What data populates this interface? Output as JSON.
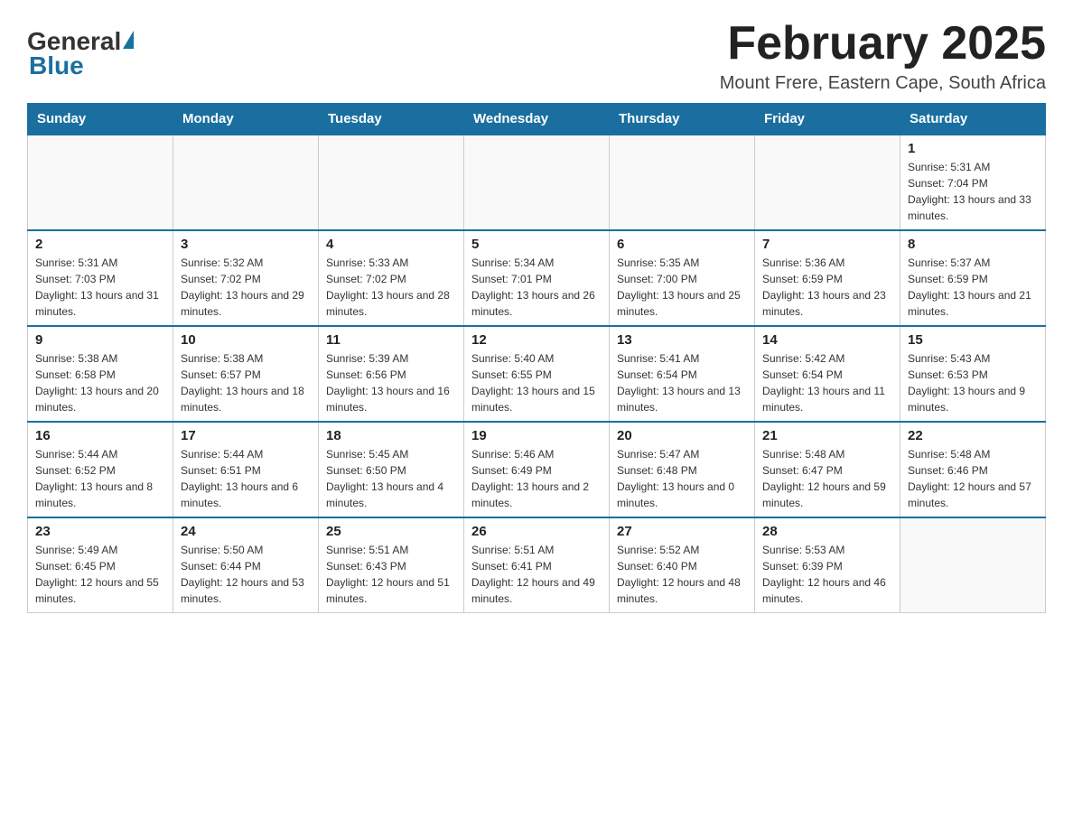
{
  "logo": {
    "general": "General",
    "blue": "Blue"
  },
  "title": "February 2025",
  "subtitle": "Mount Frere, Eastern Cape, South Africa",
  "days_of_week": [
    "Sunday",
    "Monday",
    "Tuesday",
    "Wednesday",
    "Thursday",
    "Friday",
    "Saturday"
  ],
  "weeks": [
    [
      {
        "day": "",
        "info": ""
      },
      {
        "day": "",
        "info": ""
      },
      {
        "day": "",
        "info": ""
      },
      {
        "day": "",
        "info": ""
      },
      {
        "day": "",
        "info": ""
      },
      {
        "day": "",
        "info": ""
      },
      {
        "day": "1",
        "info": "Sunrise: 5:31 AM\nSunset: 7:04 PM\nDaylight: 13 hours and 33 minutes."
      }
    ],
    [
      {
        "day": "2",
        "info": "Sunrise: 5:31 AM\nSunset: 7:03 PM\nDaylight: 13 hours and 31 minutes."
      },
      {
        "day": "3",
        "info": "Sunrise: 5:32 AM\nSunset: 7:02 PM\nDaylight: 13 hours and 29 minutes."
      },
      {
        "day": "4",
        "info": "Sunrise: 5:33 AM\nSunset: 7:02 PM\nDaylight: 13 hours and 28 minutes."
      },
      {
        "day": "5",
        "info": "Sunrise: 5:34 AM\nSunset: 7:01 PM\nDaylight: 13 hours and 26 minutes."
      },
      {
        "day": "6",
        "info": "Sunrise: 5:35 AM\nSunset: 7:00 PM\nDaylight: 13 hours and 25 minutes."
      },
      {
        "day": "7",
        "info": "Sunrise: 5:36 AM\nSunset: 6:59 PM\nDaylight: 13 hours and 23 minutes."
      },
      {
        "day": "8",
        "info": "Sunrise: 5:37 AM\nSunset: 6:59 PM\nDaylight: 13 hours and 21 minutes."
      }
    ],
    [
      {
        "day": "9",
        "info": "Sunrise: 5:38 AM\nSunset: 6:58 PM\nDaylight: 13 hours and 20 minutes."
      },
      {
        "day": "10",
        "info": "Sunrise: 5:38 AM\nSunset: 6:57 PM\nDaylight: 13 hours and 18 minutes."
      },
      {
        "day": "11",
        "info": "Sunrise: 5:39 AM\nSunset: 6:56 PM\nDaylight: 13 hours and 16 minutes."
      },
      {
        "day": "12",
        "info": "Sunrise: 5:40 AM\nSunset: 6:55 PM\nDaylight: 13 hours and 15 minutes."
      },
      {
        "day": "13",
        "info": "Sunrise: 5:41 AM\nSunset: 6:54 PM\nDaylight: 13 hours and 13 minutes."
      },
      {
        "day": "14",
        "info": "Sunrise: 5:42 AM\nSunset: 6:54 PM\nDaylight: 13 hours and 11 minutes."
      },
      {
        "day": "15",
        "info": "Sunrise: 5:43 AM\nSunset: 6:53 PM\nDaylight: 13 hours and 9 minutes."
      }
    ],
    [
      {
        "day": "16",
        "info": "Sunrise: 5:44 AM\nSunset: 6:52 PM\nDaylight: 13 hours and 8 minutes."
      },
      {
        "day": "17",
        "info": "Sunrise: 5:44 AM\nSunset: 6:51 PM\nDaylight: 13 hours and 6 minutes."
      },
      {
        "day": "18",
        "info": "Sunrise: 5:45 AM\nSunset: 6:50 PM\nDaylight: 13 hours and 4 minutes."
      },
      {
        "day": "19",
        "info": "Sunrise: 5:46 AM\nSunset: 6:49 PM\nDaylight: 13 hours and 2 minutes."
      },
      {
        "day": "20",
        "info": "Sunrise: 5:47 AM\nSunset: 6:48 PM\nDaylight: 13 hours and 0 minutes."
      },
      {
        "day": "21",
        "info": "Sunrise: 5:48 AM\nSunset: 6:47 PM\nDaylight: 12 hours and 59 minutes."
      },
      {
        "day": "22",
        "info": "Sunrise: 5:48 AM\nSunset: 6:46 PM\nDaylight: 12 hours and 57 minutes."
      }
    ],
    [
      {
        "day": "23",
        "info": "Sunrise: 5:49 AM\nSunset: 6:45 PM\nDaylight: 12 hours and 55 minutes."
      },
      {
        "day": "24",
        "info": "Sunrise: 5:50 AM\nSunset: 6:44 PM\nDaylight: 12 hours and 53 minutes."
      },
      {
        "day": "25",
        "info": "Sunrise: 5:51 AM\nSunset: 6:43 PM\nDaylight: 12 hours and 51 minutes."
      },
      {
        "day": "26",
        "info": "Sunrise: 5:51 AM\nSunset: 6:41 PM\nDaylight: 12 hours and 49 minutes."
      },
      {
        "day": "27",
        "info": "Sunrise: 5:52 AM\nSunset: 6:40 PM\nDaylight: 12 hours and 48 minutes."
      },
      {
        "day": "28",
        "info": "Sunrise: 5:53 AM\nSunset: 6:39 PM\nDaylight: 12 hours and 46 minutes."
      },
      {
        "day": "",
        "info": ""
      }
    ]
  ]
}
